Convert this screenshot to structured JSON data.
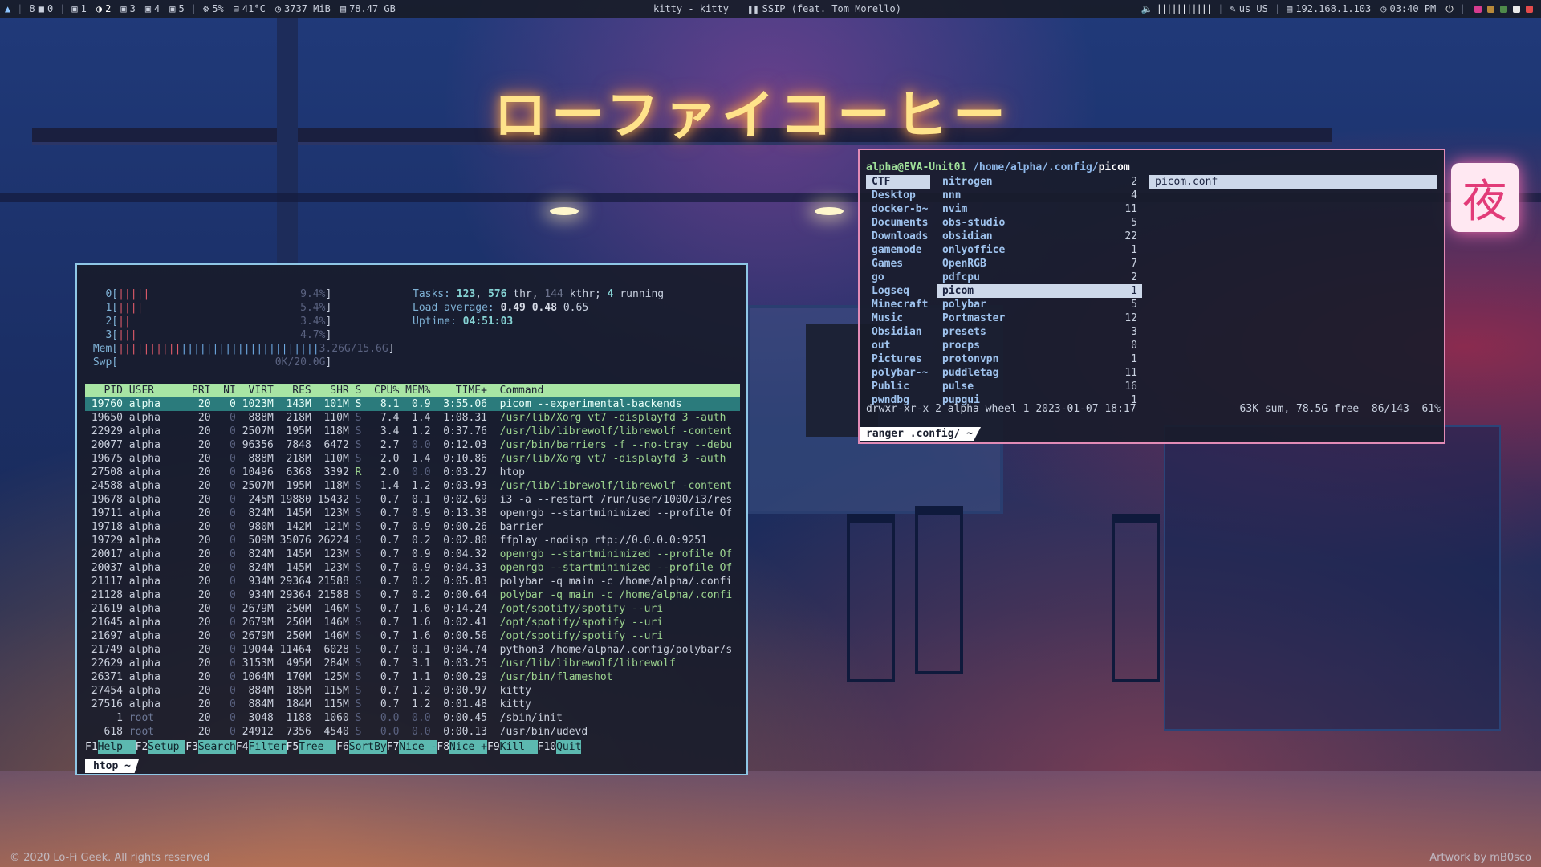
{
  "topbar": {
    "arch_icon": "arch-linux-icon",
    "counters": [
      "8",
      "0"
    ],
    "workspaces": [
      {
        "num": "1",
        "icon": "terminal-icon"
      },
      {
        "num": "2",
        "icon": "firefox-icon",
        "active": true
      },
      {
        "num": "3",
        "icon": "folder-icon"
      },
      {
        "num": "4",
        "icon": "chat-icon"
      },
      {
        "num": "5",
        "icon": "music-icon"
      }
    ],
    "cpu": "5%",
    "temp": "41°C",
    "mem": "3737 MiB",
    "disk": "78.47 GB",
    "window_title": "kitty - kitty",
    "song": "SSIP (feat. Tom Morello)",
    "volume_bars": "|||||||||||",
    "keyboard": "us_US",
    "ip": "192.168.1.103",
    "time": "03:40 PM"
  },
  "htop": {
    "cpu_meters": [
      {
        "label": "0",
        "bars": "|||||",
        "pct": "9.4%"
      },
      {
        "label": "1",
        "bars": "||||",
        "pct": "5.4%"
      },
      {
        "label": "2",
        "bars": "||",
        "pct": "3.4%"
      },
      {
        "label": "3",
        "bars": "|||",
        "pct": "4.7%"
      }
    ],
    "mem": {
      "label": "Mem",
      "bars_red": "||||||||||",
      "bars_blue": "||||||||||||||||||||||",
      "value": "3.26G/15.6G"
    },
    "swp": {
      "label": "Swp",
      "value": "0K/20.0G"
    },
    "tasks": {
      "label": "Tasks:",
      "tasks": "123",
      "thr": "576",
      "kthr": "144",
      "running": "4"
    },
    "load": {
      "label": "Load average:",
      "v1": "0.49",
      "v2": "0.48",
      "v3": "0.65"
    },
    "uptime": {
      "label": "Uptime:",
      "value": "04:51:03"
    },
    "columns": [
      "PID",
      "USER",
      "PRI",
      "NI",
      "VIRT",
      "RES",
      "SHR",
      "S",
      "CPU%",
      "MEM%",
      "TIME+",
      "Command"
    ],
    "rows": [
      {
        "pid": "19760",
        "user": "alpha",
        "pri": "20",
        "ni": "0",
        "virt": "1023M",
        "res": "143M",
        "shr": "101M",
        "s": "S",
        "cpu": "8.1",
        "mem": "0.9",
        "time": "3:55.06",
        "cmd": "picom --experimental-backends"
      },
      {
        "pid": "19650",
        "user": "alpha",
        "pri": "20",
        "ni": "0",
        "virt": "888M",
        "res": "218M",
        "shr": "110M",
        "s": "S",
        "cpu": "7.4",
        "mem": "1.4",
        "time": "1:08.31",
        "cmd": "/usr/lib/Xorg vt7 -displayfd 3 -auth"
      },
      {
        "pid": "22929",
        "user": "alpha",
        "pri": "20",
        "ni": "0",
        "virt": "2507M",
        "res": "195M",
        "shr": "118M",
        "s": "S",
        "cpu": "3.4",
        "mem": "1.2",
        "time": "0:37.76",
        "cmd": "/usr/lib/librewolf/librewolf -content"
      },
      {
        "pid": "20077",
        "user": "alpha",
        "pri": "20",
        "ni": "0",
        "virt": "96356",
        "res": "7848",
        "shr": "6472",
        "s": "S",
        "cpu": "2.7",
        "mem": "0.0",
        "time": "0:12.03",
        "cmd": "/usr/bin/barriers -f --no-tray --debu"
      },
      {
        "pid": "19675",
        "user": "alpha",
        "pri": "20",
        "ni": "0",
        "virt": "888M",
        "res": "218M",
        "shr": "110M",
        "s": "S",
        "cpu": "2.0",
        "mem": "1.4",
        "time": "0:10.86",
        "cmd": "/usr/lib/Xorg vt7 -displayfd 3 -auth"
      },
      {
        "pid": "27508",
        "user": "alpha",
        "pri": "20",
        "ni": "0",
        "virt": "10496",
        "res": "6368",
        "shr": "3392",
        "s": "R",
        "cpu": "2.0",
        "mem": "0.0",
        "time": "0:03.27",
        "cmd": "htop"
      },
      {
        "pid": "24588",
        "user": "alpha",
        "pri": "20",
        "ni": "0",
        "virt": "2507M",
        "res": "195M",
        "shr": "118M",
        "s": "S",
        "cpu": "1.4",
        "mem": "1.2",
        "time": "0:03.93",
        "cmd": "/usr/lib/librewolf/librewolf -content"
      },
      {
        "pid": "19678",
        "user": "alpha",
        "pri": "20",
        "ni": "0",
        "virt": "245M",
        "res": "19880",
        "shr": "15432",
        "s": "S",
        "cpu": "0.7",
        "mem": "0.1",
        "time": "0:02.69",
        "cmd": "i3 -a --restart /run/user/1000/i3/res"
      },
      {
        "pid": "19711",
        "user": "alpha",
        "pri": "20",
        "ni": "0",
        "virt": "824M",
        "res": "145M",
        "shr": "123M",
        "s": "S",
        "cpu": "0.7",
        "mem": "0.9",
        "time": "0:13.38",
        "cmd": "openrgb --startminimized --profile Of"
      },
      {
        "pid": "19718",
        "user": "alpha",
        "pri": "20",
        "ni": "0",
        "virt": "980M",
        "res": "142M",
        "shr": "121M",
        "s": "S",
        "cpu": "0.7",
        "mem": "0.9",
        "time": "0:00.26",
        "cmd": "barrier"
      },
      {
        "pid": "19729",
        "user": "alpha",
        "pri": "20",
        "ni": "0",
        "virt": "509M",
        "res": "35076",
        "shr": "26224",
        "s": "S",
        "cpu": "0.7",
        "mem": "0.2",
        "time": "0:02.80",
        "cmd": "ffplay -nodisp rtp://0.0.0.0:9251"
      },
      {
        "pid": "20017",
        "user": "alpha",
        "pri": "20",
        "ni": "0",
        "virt": "824M",
        "res": "145M",
        "shr": "123M",
        "s": "S",
        "cpu": "0.7",
        "mem": "0.9",
        "time": "0:04.32",
        "cmd": "openrgb --startminimized --profile Of"
      },
      {
        "pid": "20037",
        "user": "alpha",
        "pri": "20",
        "ni": "0",
        "virt": "824M",
        "res": "145M",
        "shr": "123M",
        "s": "S",
        "cpu": "0.7",
        "mem": "0.9",
        "time": "0:04.33",
        "cmd": "openrgb --startminimized --profile Of"
      },
      {
        "pid": "21117",
        "user": "alpha",
        "pri": "20",
        "ni": "0",
        "virt": "934M",
        "res": "29364",
        "shr": "21588",
        "s": "S",
        "cpu": "0.7",
        "mem": "0.2",
        "time": "0:05.83",
        "cmd": "polybar -q main -c /home/alpha/.confi"
      },
      {
        "pid": "21128",
        "user": "alpha",
        "pri": "20",
        "ni": "0",
        "virt": "934M",
        "res": "29364",
        "shr": "21588",
        "s": "S",
        "cpu": "0.7",
        "mem": "0.2",
        "time": "0:00.64",
        "cmd": "polybar -q main -c /home/alpha/.confi"
      },
      {
        "pid": "21619",
        "user": "alpha",
        "pri": "20",
        "ni": "0",
        "virt": "2679M",
        "res": "250M",
        "shr": "146M",
        "s": "S",
        "cpu": "0.7",
        "mem": "1.6",
        "time": "0:14.24",
        "cmd": "/opt/spotify/spotify --uri"
      },
      {
        "pid": "21645",
        "user": "alpha",
        "pri": "20",
        "ni": "0",
        "virt": "2679M",
        "res": "250M",
        "shr": "146M",
        "s": "S",
        "cpu": "0.7",
        "mem": "1.6",
        "time": "0:02.41",
        "cmd": "/opt/spotify/spotify --uri"
      },
      {
        "pid": "21697",
        "user": "alpha",
        "pri": "20",
        "ni": "0",
        "virt": "2679M",
        "res": "250M",
        "shr": "146M",
        "s": "S",
        "cpu": "0.7",
        "mem": "1.6",
        "time": "0:00.56",
        "cmd": "/opt/spotify/spotify --uri"
      },
      {
        "pid": "21749",
        "user": "alpha",
        "pri": "20",
        "ni": "0",
        "virt": "19044",
        "res": "11464",
        "shr": "6028",
        "s": "S",
        "cpu": "0.7",
        "mem": "0.1",
        "time": "0:04.74",
        "cmd": "python3 /home/alpha/.config/polybar/s"
      },
      {
        "pid": "22629",
        "user": "alpha",
        "pri": "20",
        "ni": "0",
        "virt": "3153M",
        "res": "495M",
        "shr": "284M",
        "s": "S",
        "cpu": "0.7",
        "mem": "3.1",
        "time": "0:03.25",
        "cmd": "/usr/lib/librewolf/librewolf"
      },
      {
        "pid": "26371",
        "user": "alpha",
        "pri": "20",
        "ni": "0",
        "virt": "1064M",
        "res": "170M",
        "shr": "125M",
        "s": "S",
        "cpu": "0.7",
        "mem": "1.1",
        "time": "0:00.29",
        "cmd": "/usr/bin/flameshot"
      },
      {
        "pid": "27454",
        "user": "alpha",
        "pri": "20",
        "ni": "0",
        "virt": "884M",
        "res": "185M",
        "shr": "115M",
        "s": "S",
        "cpu": "0.7",
        "mem": "1.2",
        "time": "0:00.97",
        "cmd": "kitty"
      },
      {
        "pid": "27516",
        "user": "alpha",
        "pri": "20",
        "ni": "0",
        "virt": "884M",
        "res": "184M",
        "shr": "115M",
        "s": "S",
        "cpu": "0.7",
        "mem": "1.2",
        "time": "0:01.48",
        "cmd": "kitty"
      },
      {
        "pid": "1",
        "user": "root",
        "pri": "20",
        "ni": "0",
        "virt": "3048",
        "res": "1188",
        "shr": "1060",
        "s": "S",
        "cpu": "0.0",
        "mem": "0.0",
        "time": "0:00.45",
        "cmd": "/sbin/init"
      },
      {
        "pid": "618",
        "user": "root",
        "pri": "20",
        "ni": "0",
        "virt": "24912",
        "res": "7356",
        "shr": "4540",
        "s": "S",
        "cpu": "0.0",
        "mem": "0.0",
        "time": "0:00.13",
        "cmd": "/usr/bin/udevd"
      }
    ],
    "green_cmd_rows": [
      0,
      1,
      2,
      3,
      4,
      6,
      11,
      12,
      14,
      15,
      16,
      17,
      19,
      20
    ],
    "footer": [
      {
        "key": "F1",
        "label": "Help  "
      },
      {
        "key": "F2",
        "label": "Setup "
      },
      {
        "key": "F3",
        "label": "Search"
      },
      {
        "key": "F4",
        "label": "Filter"
      },
      {
        "key": "F5",
        "label": "Tree  "
      },
      {
        "key": "F6",
        "label": "SortBy"
      },
      {
        "key": "F7",
        "label": "Nice -"
      },
      {
        "key": "F8",
        "label": "Nice +"
      },
      {
        "key": "F9",
        "label": "Kill  "
      },
      {
        "key": "F10",
        "label": "Quit"
      }
    ],
    "status_tab": "htop ~"
  },
  "ranger": {
    "user_host": "alpha@EVA-Unit01",
    "path": "/home/alpha/.config/",
    "current": "picom",
    "parent_dirs": [
      "CTF",
      "Desktop",
      "docker-b~",
      "Documents",
      "Downloads",
      "gamemode",
      "Games",
      "go",
      "Logseq",
      "Minecraft",
      "Music",
      "Obsidian",
      "out",
      "Pictures",
      "polybar-~",
      "Public",
      "pwndbg"
    ],
    "parent_selected": 0,
    "entries": [
      {
        "name": "nitrogen",
        "count": "2"
      },
      {
        "name": "nnn",
        "count": "4"
      },
      {
        "name": "nvim",
        "count": "11"
      },
      {
        "name": "obs-studio",
        "count": "5"
      },
      {
        "name": "obsidian",
        "count": "22"
      },
      {
        "name": "onlyoffice",
        "count": "1"
      },
      {
        "name": "OpenRGB",
        "count": "7"
      },
      {
        "name": "pdfcpu",
        "count": "2"
      },
      {
        "name": "picom",
        "count": "1"
      },
      {
        "name": "polybar",
        "count": "5"
      },
      {
        "name": "Portmaster",
        "count": "12"
      },
      {
        "name": "presets",
        "count": "3"
      },
      {
        "name": "procps",
        "count": "0"
      },
      {
        "name": "protonvpn",
        "count": "1"
      },
      {
        "name": "puddletag",
        "count": "11"
      },
      {
        "name": "pulse",
        "count": "16"
      },
      {
        "name": "pupgui",
        "count": "1"
      }
    ],
    "entry_selected": 8,
    "preview": [
      "picom.conf"
    ],
    "status_left": "drwxr-xr-x 2 alpha wheel 1 2023-01-07 18:17",
    "status_right": "63K sum, 78.5G free  86/143  61%",
    "status_tab": "ranger .config/ ~"
  },
  "wallpaper": {
    "neon_sign": "ローファイコーヒー",
    "kanji": "夜",
    "copyright": "© 2020 Lo-Fi Geek. All rights reserved",
    "artwork_credit": "Artwork by mB0sco"
  },
  "colors": {
    "htop_border": "#8fc7e6",
    "ranger_border": "#e28bb6",
    "htop_header": "#a8e5a4",
    "htop_selected": "#2b7b7c",
    "footer_label": "#5cb9b0"
  }
}
